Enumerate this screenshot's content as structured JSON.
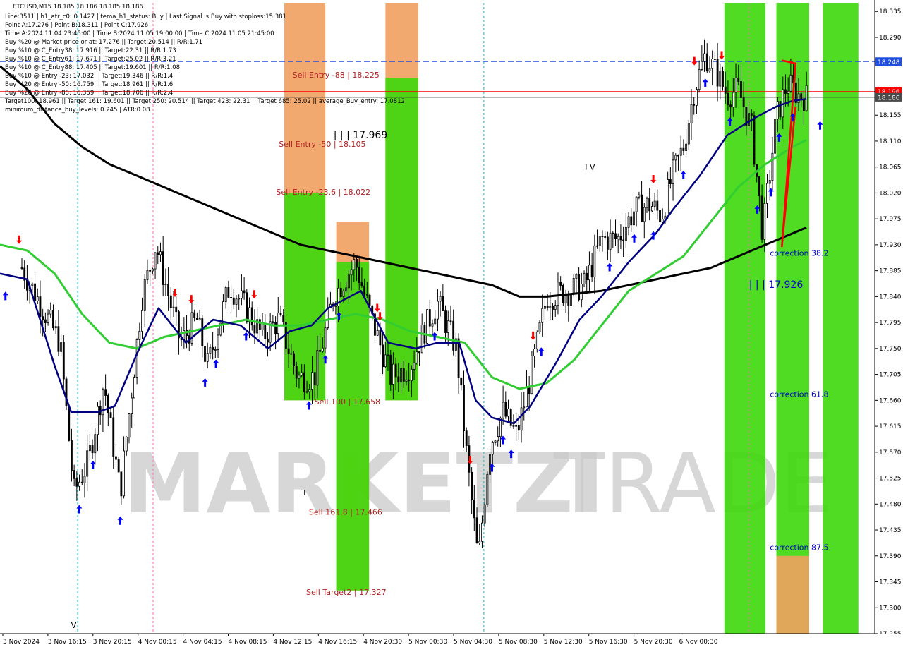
{
  "header": {
    "symbol_line": "ETCUSD,M15  18.185 18.186 18.185 18.186",
    "info_lines": [
      "Line:3511 | h1_atr_c0: 0.1427 | tema_h1_status: Buy | Last Signal is:Buy with stoploss:15.381",
      "Point A:17.276 | Point B:18.311 | Point C:17.926",
      "Time A:2024.11.04 23:45:00 | Time B:2024.11.05 19:00:00 | Time C:2024.11.05 21:45:00",
      "Buy %20 @ Market price or at: 17.276 || Target:20.514 || R/R:1.71",
      "Buy %10 @ C_Entry38: 17.916 || Target:22.31 || R/R:1.73",
      "Buy %10 @ C_Entry61: 17.671 || Target:25.02 || R/R:3.21",
      "Buy %10 @ C_Entry88: 17.405 || Target:19.601 || R/R:1.08",
      "Buy %10 @ Entry -23: 17.032 || Target:19.346 || R/R:1.4",
      "Buy %20 @ Entry -50: 16.759 || Target:18.961 || R/R:1.6",
      "Buy %20 @ Entry -88: 16.359 || Target:18.706 || R/R:2.4",
      "Target100: 18.961 || Target 161: 19.601 || Target 250: 20.514 || Target 423: 22.31 || Target 685: 25.02 ||  average_Buy_entry: 17.0812",
      "minimum_distance_buy_levels: 0.245 | ATR:0.08"
    ]
  },
  "watermark": {
    "part1": "MARKETZI",
    "part2": "TRADE"
  },
  "colors": {
    "bull": "#000000",
    "bear": "#000000",
    "ema_fast": "#000080",
    "ema_mid": "#32cd32",
    "ema_slow": "#000000",
    "green_zone": "#3cd80a",
    "orange_zone": "#f0a060",
    "sell_text": "#b22222",
    "blue_text": "#0000cd",
    "price_red": "#ff0000",
    "price_blue": "#1e4fe0"
  },
  "chart_data": {
    "type": "candlestick",
    "symbol": "ETCUSD",
    "timeframe": "M15",
    "ylim": [
      17.255,
      18.35
    ],
    "y_ticks": [
      17.255,
      17.3,
      17.345,
      17.39,
      17.435,
      17.48,
      17.525,
      17.57,
      17.615,
      17.66,
      17.705,
      17.75,
      17.795,
      17.84,
      17.885,
      17.93,
      17.975,
      18.02,
      18.065,
      18.11,
      18.155,
      18.2,
      18.245,
      18.29,
      18.335
    ],
    "y_tick_labels": [
      "17.255",
      "17.300",
      "17.345",
      "17.390",
      "17.435",
      "17.480",
      "17.525",
      "17.570",
      "17.615",
      "17.660",
      "17.705",
      "17.750",
      "17.795",
      "17.840",
      "17.885",
      "17.930",
      "17.975",
      "18.020",
      "18.065",
      "18.110",
      "18.155",
      "18.200",
      "18.245",
      "18.290",
      "18.335"
    ],
    "x_labels": [
      "3 Nov 2024",
      "3 Nov 16:15",
      "3 Nov 20:15",
      "4 Nov 00:15",
      "4 Nov 04:15",
      "4 Nov 08:15",
      "4 Nov 12:15",
      "4 Nov 16:15",
      "4 Nov 20:30",
      "5 Nov 00:30",
      "5 Nov 04:30",
      "5 Nov 08:30",
      "5 Nov 12:30",
      "5 Nov 16:30",
      "5 Nov 20:30",
      "6 Nov 00:30"
    ],
    "key_points": [
      {
        "t": 0.4,
        "p": 17.89
      },
      {
        "t": 1.1,
        "p": 17.76
      },
      {
        "t": 1.35,
        "p": 17.5
      },
      {
        "t": 1.6,
        "p": 17.55
      },
      {
        "t": 1.9,
        "p": 17.69
      },
      {
        "t": 2.2,
        "p": 17.5
      },
      {
        "t": 2.6,
        "p": 17.84
      },
      {
        "t": 2.85,
        "p": 17.93
      },
      {
        "t": 3.3,
        "p": 17.76
      },
      {
        "t": 3.6,
        "p": 17.8
      },
      {
        "t": 3.8,
        "p": 17.72
      },
      {
        "t": 4.2,
        "p": 17.86
      },
      {
        "t": 4.5,
        "p": 17.82
      },
      {
        "t": 4.8,
        "p": 17.77
      },
      {
        "t": 5.1,
        "p": 17.8
      },
      {
        "t": 5.45,
        "p": 17.7
      },
      {
        "t": 5.75,
        "p": 17.7
      },
      {
        "t": 6.1,
        "p": 17.84
      },
      {
        "t": 6.5,
        "p": 17.9
      },
      {
        "t": 6.8,
        "p": 17.8
      },
      {
        "t": 7.15,
        "p": 17.7
      },
      {
        "t": 7.5,
        "p": 17.72
      },
      {
        "t": 7.75,
        "p": 17.78
      },
      {
        "t": 8.0,
        "p": 17.83
      },
      {
        "t": 8.35,
        "p": 17.75
      },
      {
        "t": 8.55,
        "p": 17.55
      },
      {
        "t": 8.75,
        "p": 17.38
      },
      {
        "t": 8.95,
        "p": 17.58
      },
      {
        "t": 9.2,
        "p": 17.64
      },
      {
        "t": 9.45,
        "p": 17.6
      },
      {
        "t": 9.7,
        "p": 17.7
      },
      {
        "t": 10.0,
        "p": 17.84
      },
      {
        "t": 10.4,
        "p": 17.85
      },
      {
        "t": 10.7,
        "p": 17.86
      },
      {
        "t": 11.0,
        "p": 17.94
      },
      {
        "t": 11.3,
        "p": 17.94
      },
      {
        "t": 11.6,
        "p": 17.99
      },
      {
        "t": 11.9,
        "p": 18.0
      },
      {
        "t": 12.1,
        "p": 17.98
      },
      {
        "t": 12.3,
        "p": 18.05
      },
      {
        "t": 12.5,
        "p": 18.1
      },
      {
        "t": 12.7,
        "p": 18.2
      },
      {
        "t": 12.9,
        "p": 18.26
      },
      {
        "t": 13.1,
        "p": 18.23
      },
      {
        "t": 13.3,
        "p": 18.19
      },
      {
        "t": 13.5,
        "p": 18.2
      },
      {
        "t": 13.75,
        "p": 18.13
      },
      {
        "t": 13.95,
        "p": 17.95
      },
      {
        "t": 14.2,
        "p": 18.15
      },
      {
        "t": 14.4,
        "p": 18.21
      },
      {
        "t": 14.6,
        "p": 18.19
      },
      {
        "t": 14.75,
        "p": 18.186
      }
    ],
    "ema_fast": [
      {
        "t": 0.0,
        "p": 17.88
      },
      {
        "t": 0.5,
        "p": 17.87
      },
      {
        "t": 1.0,
        "p": 17.72
      },
      {
        "t": 1.3,
        "p": 17.64
      },
      {
        "t": 1.8,
        "p": 17.64
      },
      {
        "t": 2.1,
        "p": 17.65
      },
      {
        "t": 2.5,
        "p": 17.74
      },
      {
        "t": 2.9,
        "p": 17.82
      },
      {
        "t": 3.4,
        "p": 17.76
      },
      {
        "t": 3.9,
        "p": 17.8
      },
      {
        "t": 4.4,
        "p": 17.79
      },
      {
        "t": 4.9,
        "p": 17.75
      },
      {
        "t": 5.3,
        "p": 17.78
      },
      {
        "t": 5.7,
        "p": 17.79
      },
      {
        "t": 6.0,
        "p": 17.82
      },
      {
        "t": 6.6,
        "p": 17.85
      },
      {
        "t": 7.1,
        "p": 17.76
      },
      {
        "t": 7.6,
        "p": 17.75
      },
      {
        "t": 8.0,
        "p": 17.76
      },
      {
        "t": 8.4,
        "p": 17.76
      },
      {
        "t": 8.7,
        "p": 17.66
      },
      {
        "t": 9.0,
        "p": 17.63
      },
      {
        "t": 9.4,
        "p": 17.62
      },
      {
        "t": 9.7,
        "p": 17.65
      },
      {
        "t": 10.2,
        "p": 17.73
      },
      {
        "t": 10.6,
        "p": 17.8
      },
      {
        "t": 11.0,
        "p": 17.84
      },
      {
        "t": 11.5,
        "p": 17.9
      },
      {
        "t": 12.0,
        "p": 17.95
      },
      {
        "t": 12.3,
        "p": 17.99
      },
      {
        "t": 12.8,
        "p": 18.05
      },
      {
        "t": 13.3,
        "p": 18.12
      },
      {
        "t": 13.8,
        "p": 18.15
      },
      {
        "t": 14.2,
        "p": 18.17
      },
      {
        "t": 14.5,
        "p": 18.18
      },
      {
        "t": 14.75,
        "p": 18.183
      }
    ],
    "ema_mid": [
      {
        "t": 0.0,
        "p": 17.93
      },
      {
        "t": 0.5,
        "p": 17.92
      },
      {
        "t": 1.0,
        "p": 17.88
      },
      {
        "t": 1.5,
        "p": 17.81
      },
      {
        "t": 2.0,
        "p": 17.76
      },
      {
        "t": 2.5,
        "p": 17.75
      },
      {
        "t": 3.0,
        "p": 17.77
      },
      {
        "t": 3.5,
        "p": 17.78
      },
      {
        "t": 4.0,
        "p": 17.79
      },
      {
        "t": 4.5,
        "p": 17.8
      },
      {
        "t": 5.0,
        "p": 17.79
      },
      {
        "t": 5.5,
        "p": 17.79
      },
      {
        "t": 6.0,
        "p": 17.8
      },
      {
        "t": 6.5,
        "p": 17.81
      },
      {
        "t": 7.0,
        "p": 17.8
      },
      {
        "t": 7.5,
        "p": 17.78
      },
      {
        "t": 8.0,
        "p": 17.77
      },
      {
        "t": 8.5,
        "p": 17.76
      },
      {
        "t": 9.0,
        "p": 17.7
      },
      {
        "t": 9.5,
        "p": 17.68
      },
      {
        "t": 10.0,
        "p": 17.69
      },
      {
        "t": 10.5,
        "p": 17.73
      },
      {
        "t": 11.0,
        "p": 17.79
      },
      {
        "t": 11.5,
        "p": 17.85
      },
      {
        "t": 12.0,
        "p": 17.88
      },
      {
        "t": 12.5,
        "p": 17.91
      },
      {
        "t": 13.0,
        "p": 17.97
      },
      {
        "t": 13.5,
        "p": 18.03
      },
      {
        "t": 14.0,
        "p": 18.07
      },
      {
        "t": 14.5,
        "p": 18.1
      },
      {
        "t": 14.75,
        "p": 18.112
      }
    ],
    "ema_slow": [
      {
        "t": 0.0,
        "p": 18.24
      },
      {
        "t": 0.5,
        "p": 18.2
      },
      {
        "t": 1.0,
        "p": 18.14
      },
      {
        "t": 1.5,
        "p": 18.1
      },
      {
        "t": 2.0,
        "p": 18.07
      },
      {
        "t": 2.5,
        "p": 18.05
      },
      {
        "t": 3.0,
        "p": 18.03
      },
      {
        "t": 3.5,
        "p": 18.01
      },
      {
        "t": 4.0,
        "p": 17.99
      },
      {
        "t": 4.5,
        "p": 17.97
      },
      {
        "t": 5.0,
        "p": 17.95
      },
      {
        "t": 5.5,
        "p": 17.93
      },
      {
        "t": 6.0,
        "p": 17.92
      },
      {
        "t": 6.5,
        "p": 17.91
      },
      {
        "t": 7.0,
        "p": 17.9
      },
      {
        "t": 7.5,
        "p": 17.89
      },
      {
        "t": 8.0,
        "p": 17.88
      },
      {
        "t": 8.5,
        "p": 17.87
      },
      {
        "t": 9.0,
        "p": 17.86
      },
      {
        "t": 9.5,
        "p": 17.84
      },
      {
        "t": 10.0,
        "p": 17.84
      },
      {
        "t": 10.5,
        "p": 17.845
      },
      {
        "t": 11.0,
        "p": 17.85
      },
      {
        "t": 11.5,
        "p": 17.86
      },
      {
        "t": 12.0,
        "p": 17.87
      },
      {
        "t": 12.5,
        "p": 17.88
      },
      {
        "t": 13.0,
        "p": 17.89
      },
      {
        "t": 13.5,
        "p": 17.91
      },
      {
        "t": 14.0,
        "p": 17.93
      },
      {
        "t": 14.5,
        "p": 17.95
      },
      {
        "t": 14.75,
        "p": 17.96
      }
    ],
    "hlines": [
      {
        "price": 18.248,
        "label": "18.248",
        "color": "#1e4fe0",
        "style": "dashed"
      },
      {
        "price": 18.196,
        "label": "18.196",
        "color": "#ff0000",
        "style": "solid"
      },
      {
        "price": 18.186,
        "label": "18.186",
        "color": "#4a4a4a",
        "style": "solid"
      }
    ],
    "zones": [
      {
        "t0": 5.2,
        "t1": 5.95,
        "p_top": 18.35,
        "p_bot": 17.66,
        "color": "#f0a060"
      },
      {
        "t0": 5.2,
        "t1": 5.95,
        "p_top": 18.02,
        "p_bot": 17.66,
        "color": "#3cd80a"
      },
      {
        "t0": 6.15,
        "t1": 6.75,
        "p_top": 17.97,
        "p_bot": 17.33,
        "color": "#f0a060"
      },
      {
        "t0": 6.15,
        "t1": 6.75,
        "p_top": 17.9,
        "p_bot": 17.33,
        "color": "#3cd80a"
      },
      {
        "t0": 7.05,
        "t1": 7.65,
        "p_top": 18.35,
        "p_bot": 17.66,
        "color": "#f0a060"
      },
      {
        "t0": 7.05,
        "t1": 7.65,
        "p_top": 18.22,
        "p_bot": 17.66,
        "color": "#3cd80a"
      },
      {
        "t0": 13.25,
        "t1": 14.0,
        "p_top": 18.35,
        "p_bot": 17.255,
        "color": "#3cd80a"
      },
      {
        "t0": 14.2,
        "t1": 14.8,
        "p_top": 18.35,
        "p_bot": 17.255,
        "color": "#3cd80a"
      },
      {
        "t0": 14.2,
        "t1": 14.8,
        "p_top": 17.39,
        "p_bot": 17.255,
        "color": "#f0a060"
      },
      {
        "t0": 15.05,
        "t1": 15.7,
        "p_top": 18.35,
        "p_bot": 17.255,
        "color": "#3cd80a"
      }
    ],
    "level_labels": [
      {
        "text": "Sell Entry -88 | 18.225",
        "t": 5.35,
        "p": 18.225,
        "color": "#b22222"
      },
      {
        "text": "Sell Entry -50 | 18.105",
        "t": 5.1,
        "p": 18.105,
        "color": "#b22222"
      },
      {
        "text": "Sell Entry -23.6 | 18.022",
        "t": 5.05,
        "p": 18.022,
        "color": "#b22222"
      },
      {
        "text": "Sell 100 | 17.658",
        "t": 5.75,
        "p": 17.658,
        "color": "#b22222"
      },
      {
        "text": "Sell 161.8 | 17.466",
        "t": 5.65,
        "p": 17.466,
        "color": "#b22222"
      },
      {
        "text": "Sell Target2 | 17.327",
        "t": 5.6,
        "p": 17.327,
        "color": "#b22222"
      },
      {
        "text": "correction 38.2",
        "t": 14.08,
        "p": 17.916,
        "color": "#0000cd"
      },
      {
        "text": "correction 61.8",
        "t": 14.08,
        "p": 17.671,
        "color": "#0000cd"
      },
      {
        "text": "correction 87.5",
        "t": 14.08,
        "p": 17.405,
        "color": "#0000cd"
      },
      {
        "text": "| | | 17.969",
        "t": 6.1,
        "p": 18.12,
        "color": "#000000"
      },
      {
        "text": "| | | 17.926",
        "t": 13.7,
        "p": 17.86,
        "color": "#0000cd"
      },
      {
        "text": "I V",
        "t": 10.7,
        "p": 18.065,
        "color": "#000000"
      },
      {
        "text": "I",
        "t": 5.55,
        "p": 17.5,
        "color": "#000000"
      },
      {
        "text": "V",
        "t": 1.3,
        "p": 17.27,
        "color": "#000000"
      }
    ],
    "buy_arrows_t": [
      0.1,
      1.45,
      1.7,
      2.2,
      3.75,
      3.95,
      4.5,
      5.65,
      5.95,
      6.2,
      7.95,
      9.0,
      9.2,
      9.35,
      9.9,
      11.15,
      11.6,
      11.95,
      12.5,
      12.9,
      13.35,
      13.85,
      14.1,
      14.25,
      14.5,
      15.0
    ],
    "sell_arrows_t": [
      0.35,
      3.2,
      3.5,
      4.65,
      6.9,
      6.95,
      8.6,
      9.75,
      11.95,
      12.7,
      13.2
    ],
    "abc_line": [
      {
        "t": 14.3,
        "p": 18.25
      },
      {
        "t": 14.55,
        "p": 18.245
      },
      {
        "t": 14.3,
        "p": 17.926
      },
      {
        "t": 14.55,
        "p": 18.17
      }
    ]
  }
}
